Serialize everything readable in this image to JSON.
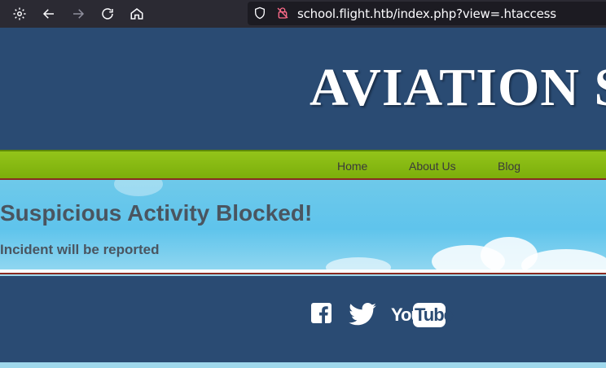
{
  "browser": {
    "url": "school.flight.htb/index.php?view=.htaccess",
    "buttons": {
      "settings_icon": "gear-icon",
      "back_icon": "arrow-left-icon",
      "forward_icon": "arrow-right-icon",
      "reload_icon": "reload-icon",
      "home_icon": "home-icon"
    }
  },
  "site": {
    "logo_text": "AVIATION S",
    "nav": [
      "Home",
      "About Us",
      "Blog"
    ],
    "heading": "Suspicious Activity Blocked!",
    "subheading": "Incident will be reported",
    "social": [
      "facebook-icon",
      "twitter-icon",
      "youtube-icon"
    ],
    "youtube_text_you": "You",
    "youtube_text_tube": "Tube"
  },
  "colors": {
    "header_bg": "#2a4b73",
    "nav_bg": "#84b512",
    "sky": "#5fc4ec",
    "heading_text": "#4a5560"
  }
}
